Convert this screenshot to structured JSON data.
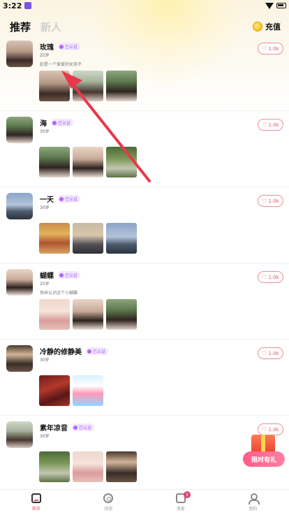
{
  "status_bar": {
    "time": "3:22"
  },
  "header": {
    "tabs": [
      {
        "label": "推荐",
        "active": true
      },
      {
        "label": "新人",
        "active": false
      }
    ],
    "recharge_label": "充值"
  },
  "feed": [
    {
      "name": "玫瑰",
      "verified": "已认证",
      "age": "25岁",
      "bio": "赵是一个爱爱的女孩子",
      "likes": "1.0k",
      "photos": [
        "portrait-a",
        "portrait-b",
        "portrait-c"
      ]
    },
    {
      "name": "海",
      "verified": "已认证",
      "age": "30岁",
      "bio": "",
      "likes": "1.0k",
      "photos": [
        "portrait-c",
        "portrait-d",
        "garden"
      ]
    },
    {
      "name": "一天",
      "verified": "已认证",
      "age": "30岁",
      "bio": "",
      "likes": "1.0k",
      "photos": [
        "market",
        "sunset",
        "beach"
      ]
    },
    {
      "name": "蝴蝶",
      "verified": "已认证",
      "age": "25岁",
      "bio": "快来认识这个小蝴蝶",
      "likes": "1.0k",
      "photos": [
        "face",
        "portrait-d",
        "portrait-c"
      ]
    },
    {
      "name": "冷静的修静美",
      "verified": "已认证",
      "age": "30岁",
      "bio": "",
      "likes": "1.0k",
      "photos": [
        "food",
        "kitty"
      ]
    },
    {
      "name": "素年凉音",
      "verified": "已认证",
      "age": "30岁",
      "bio": "",
      "likes": "1.0k",
      "photos": [
        "garden",
        "face",
        "dark"
      ]
    }
  ],
  "gift": {
    "label": "限时有礼"
  },
  "bottom_nav": [
    {
      "label": "首页",
      "icon": "home-icon",
      "active": true
    },
    {
      "label": "动态",
      "icon": "moment-icon",
      "active": false
    },
    {
      "label": "消息",
      "icon": "message-icon",
      "active": false,
      "badge": "3"
    },
    {
      "label": "我的",
      "icon": "profile-icon",
      "active": false
    }
  ],
  "colors": {
    "accent": "#e0546c",
    "verified": "#a35cf0",
    "arrow": "#e8384a"
  }
}
